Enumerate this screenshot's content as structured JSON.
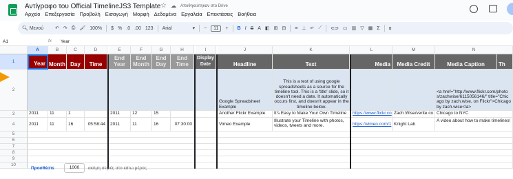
{
  "app": {
    "title": "Αντίγραφο του Official TimelineJS3 Template",
    "saved_status": "Αποθηκεύτηκαν στο Drive",
    "menus": [
      "Αρχείο",
      "Επεξεργασία",
      "Προβολή",
      "Εισαγωγή",
      "Μορφή",
      "Δεδομένα",
      "Εργαλεία",
      "Επεκτάσεις",
      "Βοήθεια"
    ]
  },
  "toolbar": {
    "search": "Μενού",
    "zoom": "100%",
    "currency": "$",
    "percent": "%",
    "dec_decrease": ".0",
    "dec_increase": ".00",
    "format_123": "123",
    "font": "Arial",
    "font_size": "11",
    "bold": "B",
    "italic": "I",
    "strike": "S",
    "text_color": "A"
  },
  "formula": {
    "cell_ref": "A1",
    "fx": "fx",
    "value": "Year"
  },
  "columns": [
    "A",
    "B",
    "C",
    "D",
    "E",
    "F",
    "G",
    "H",
    "I",
    "J",
    "K",
    "L",
    "M",
    "N"
  ],
  "rows": [
    "1",
    "2",
    "3",
    "4",
    "5",
    "6",
    "7",
    "8",
    "9",
    "10"
  ],
  "headers": {
    "year": "Year",
    "month": "Month",
    "day": "Day",
    "time": "Time",
    "end_year": "End Year",
    "end_month": "End Month",
    "end_day": "End Day",
    "end_time": "End Time",
    "display_date": "Display Date",
    "headline": "Headline",
    "text": "Text",
    "media": "Media",
    "media_credit": "Media Credit",
    "media_caption": "Media Caption",
    "next": "Th"
  },
  "row2": {
    "headline": "Google Spreadsheet Example",
    "text": "This is a test of using google spreadsheets as a source for the timeline tool. This is a 'title' slide, so it doesn't need a date. It automatically occurs first, and doesn't appear in the timeline below.",
    "caption": "<a href=\"http://www.flickr.com/photos/zachwise/6115056146/\" title=\"Chicago by zach.wise, on Flickr\">Chicago by zach.wise</a>"
  },
  "row3": {
    "year": "2011",
    "month": "11",
    "day": "1",
    "end_year": "2011",
    "end_month": "12",
    "end_day": "15",
    "headline": "Another Flickr Example",
    "text": "It's Easy to Make Your Own Timeline",
    "media": "https://www.flickr.co",
    "credit": "Zach Wise/verite.co",
    "caption": "Chicago to NYC"
  },
  "row4": {
    "year": "2011",
    "month": "11",
    "day": "16",
    "time": "05:58:44",
    "end_year": "2011",
    "end_month": "11",
    "end_day": "16",
    "end_time": "07:30:00",
    "headline": "Vimeo Example",
    "text": "Illustrate your Timeline with photos, videos, tweets and more.",
    "media": "https://vimeo.com/1",
    "credit": "Knight Lab",
    "caption": "A video about how to make timelines!"
  },
  "footer": {
    "add_label": "Προσθέστε",
    "count": "1000",
    "suffix": "ακόμη σειρές στο κάτω μέρος"
  },
  "colors": {
    "date_header": "#980000",
    "end_header": "#999999",
    "content_header": "#666666",
    "row2_bg": "#dbe5f1",
    "accent": "#0b57d0"
  }
}
